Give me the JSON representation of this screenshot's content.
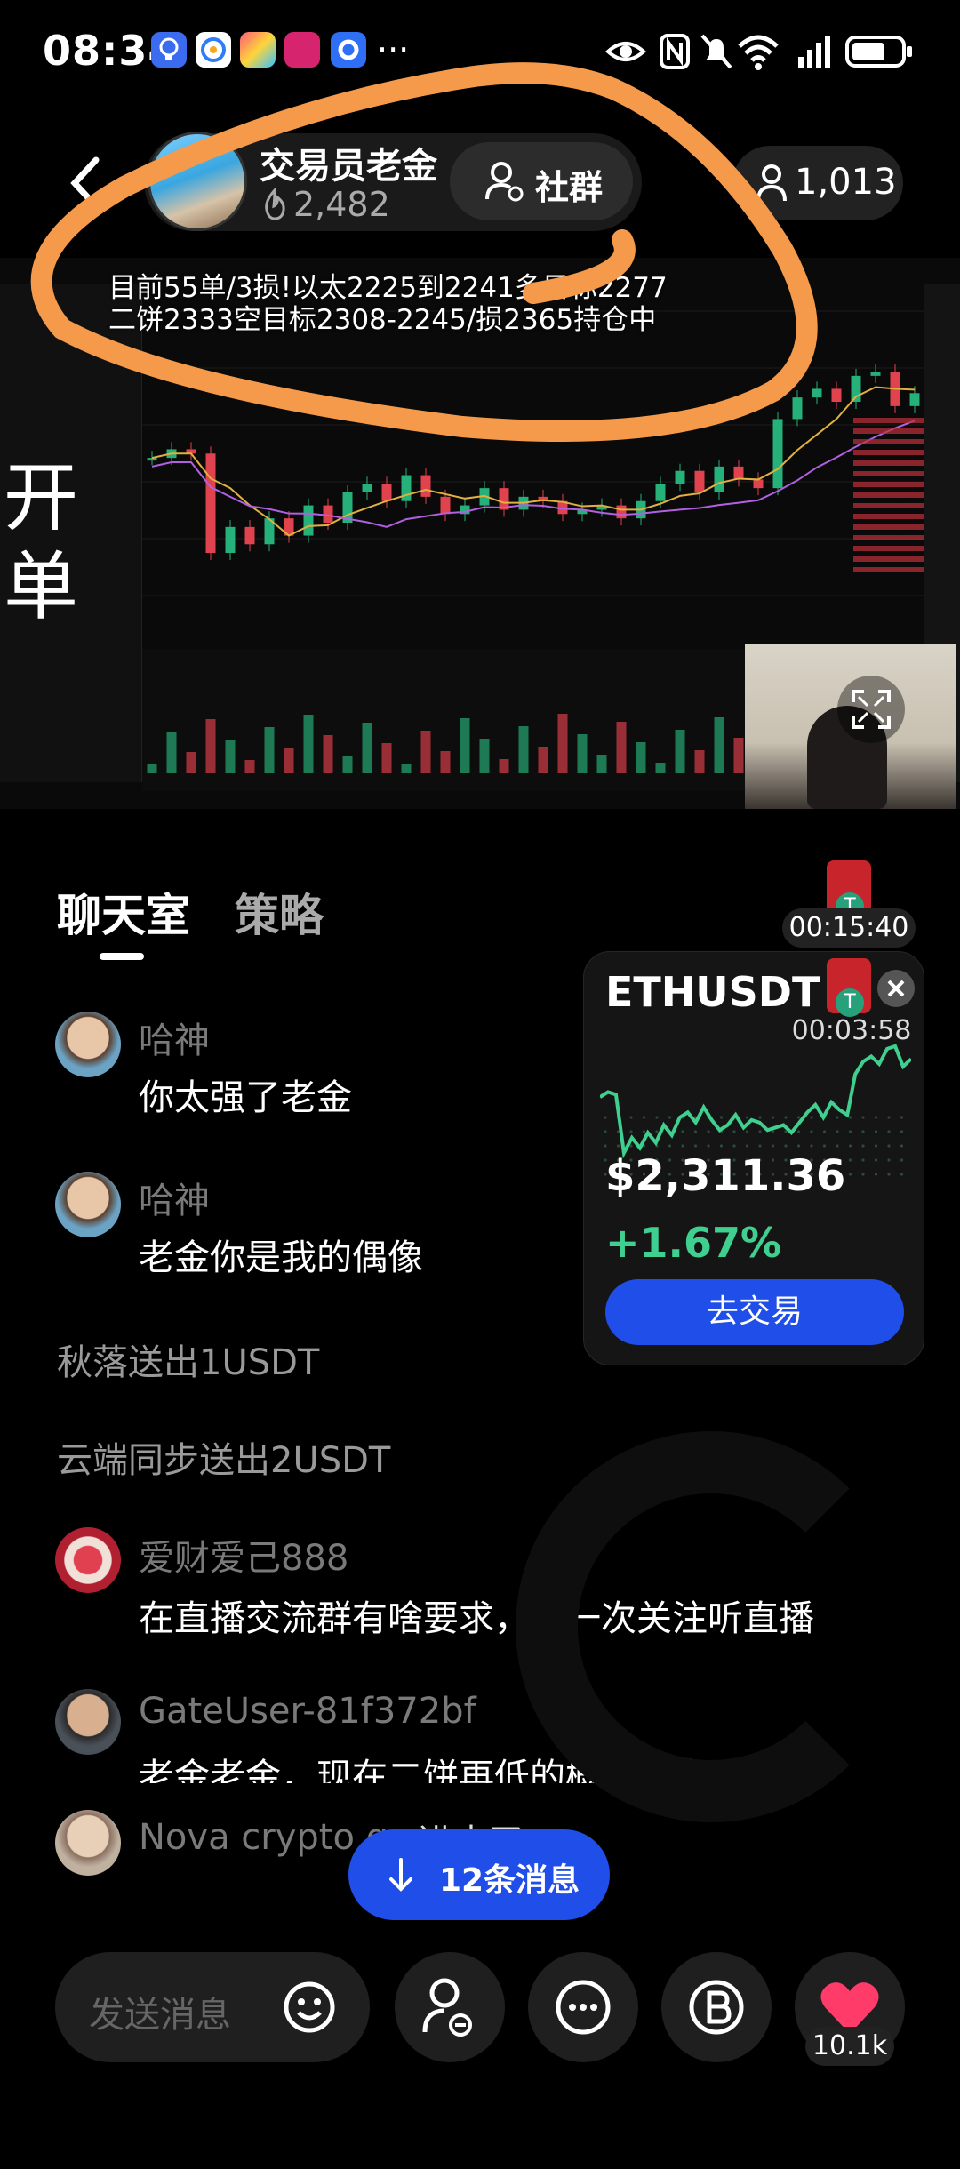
{
  "status_bar": {
    "time": "08:34",
    "notification_icons": [
      "bulb-app-icon",
      "browser-app-icon",
      "colorful-app-icon",
      "discount-app-icon",
      "circle-app-icon"
    ],
    "more": "···",
    "status_icons": [
      "eye-icon",
      "nfc-icon",
      "mute-icon",
      "wifi-icon",
      "signal-icon",
      "battery-icon"
    ]
  },
  "header": {
    "host_name": "交易员老金",
    "heat_count": "2,482",
    "community_label": "社群",
    "viewer_count": "1,013"
  },
  "stream": {
    "overlay_line1": "目前55单/3损!以太2225到2241多目标2277",
    "overlay_line2": "二饼2333空目标2308-2245/损2365持仓中",
    "side_text": "开单"
  },
  "tabs": [
    "聊天室",
    "策略"
  ],
  "timers": {
    "first": "00:15:40",
    "second": "00:03:58"
  },
  "chat": [
    {
      "name": "哈神",
      "text": "你太强了老金"
    },
    {
      "name": "哈神",
      "text": "老金你是我的偶像"
    },
    {
      "system": "秋落送出1USDT"
    },
    {
      "system": "云端同步送出2USDT"
    },
    {
      "name": "爱财爱己888",
      "text": "在直播交流群有啥要求，第一次关注听直播"
    },
    {
      "name": "GateUser-81f372bf",
      "text": "老金老金，现在二饼再低的概率还大吗"
    },
    {
      "name": "Nova crypto g...",
      "text": "进来了"
    }
  ],
  "ticker_card": {
    "symbol": "ETHUSDT",
    "price": "$2,311.36",
    "change": "+1.67%",
    "trade_label": "去交易",
    "colors": {
      "up": "#3fcf8e",
      "button": "#1f4ee8"
    }
  },
  "new_messages": "12条消息",
  "bottom_bar": {
    "placeholder": "发送消息",
    "like_count": "10.1k",
    "buttons": [
      "emoji-icon",
      "user-link-icon",
      "more-icon",
      "bitcoin-icon",
      "heart-icon"
    ]
  },
  "chart_data": {
    "type": "line",
    "title": "",
    "x": [
      1,
      2,
      3,
      4,
      5,
      6,
      7,
      8,
      9,
      10,
      11,
      12,
      13,
      14,
      15,
      16,
      17,
      18,
      19,
      20,
      21,
      22,
      23,
      24,
      25,
      26,
      27,
      28,
      29,
      30,
      31,
      32,
      33,
      34,
      35,
      36,
      37,
      38,
      39,
      40
    ],
    "series": [
      {
        "values": [
          2296,
          2298,
          2297,
          2274,
          2280,
          2276,
          2282,
          2278,
          2285,
          2281,
          2288,
          2290,
          2286,
          2292,
          2287,
          2283,
          2285,
          2289,
          2284,
          2287,
          2286,
          2283,
          2284,
          2285,
          2282,
          2286,
          2290,
          2293,
          2288,
          2294,
          2291,
          2289,
          2305,
          2310,
          2312,
          2309,
          2315,
          2316,
          2308,
          2311
        ]
      }
    ]
  }
}
